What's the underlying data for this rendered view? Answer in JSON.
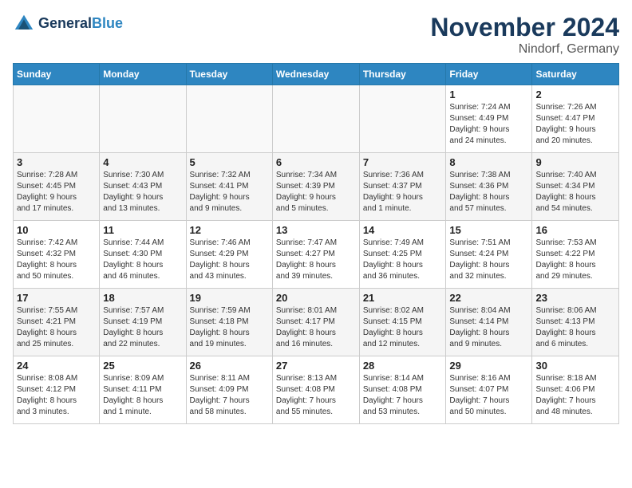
{
  "header": {
    "logo_line1": "General",
    "logo_line2": "Blue",
    "month": "November 2024",
    "location": "Nindorf, Germany"
  },
  "weekdays": [
    "Sunday",
    "Monday",
    "Tuesday",
    "Wednesday",
    "Thursday",
    "Friday",
    "Saturday"
  ],
  "weeks": [
    [
      {
        "day": "",
        "info": ""
      },
      {
        "day": "",
        "info": ""
      },
      {
        "day": "",
        "info": ""
      },
      {
        "day": "",
        "info": ""
      },
      {
        "day": "",
        "info": ""
      },
      {
        "day": "1",
        "info": "Sunrise: 7:24 AM\nSunset: 4:49 PM\nDaylight: 9 hours\nand 24 minutes."
      },
      {
        "day": "2",
        "info": "Sunrise: 7:26 AM\nSunset: 4:47 PM\nDaylight: 9 hours\nand 20 minutes."
      }
    ],
    [
      {
        "day": "3",
        "info": "Sunrise: 7:28 AM\nSunset: 4:45 PM\nDaylight: 9 hours\nand 17 minutes."
      },
      {
        "day": "4",
        "info": "Sunrise: 7:30 AM\nSunset: 4:43 PM\nDaylight: 9 hours\nand 13 minutes."
      },
      {
        "day": "5",
        "info": "Sunrise: 7:32 AM\nSunset: 4:41 PM\nDaylight: 9 hours\nand 9 minutes."
      },
      {
        "day": "6",
        "info": "Sunrise: 7:34 AM\nSunset: 4:39 PM\nDaylight: 9 hours\nand 5 minutes."
      },
      {
        "day": "7",
        "info": "Sunrise: 7:36 AM\nSunset: 4:37 PM\nDaylight: 9 hours\nand 1 minute."
      },
      {
        "day": "8",
        "info": "Sunrise: 7:38 AM\nSunset: 4:36 PM\nDaylight: 8 hours\nand 57 minutes."
      },
      {
        "day": "9",
        "info": "Sunrise: 7:40 AM\nSunset: 4:34 PM\nDaylight: 8 hours\nand 54 minutes."
      }
    ],
    [
      {
        "day": "10",
        "info": "Sunrise: 7:42 AM\nSunset: 4:32 PM\nDaylight: 8 hours\nand 50 minutes."
      },
      {
        "day": "11",
        "info": "Sunrise: 7:44 AM\nSunset: 4:30 PM\nDaylight: 8 hours\nand 46 minutes."
      },
      {
        "day": "12",
        "info": "Sunrise: 7:46 AM\nSunset: 4:29 PM\nDaylight: 8 hours\nand 43 minutes."
      },
      {
        "day": "13",
        "info": "Sunrise: 7:47 AM\nSunset: 4:27 PM\nDaylight: 8 hours\nand 39 minutes."
      },
      {
        "day": "14",
        "info": "Sunrise: 7:49 AM\nSunset: 4:25 PM\nDaylight: 8 hours\nand 36 minutes."
      },
      {
        "day": "15",
        "info": "Sunrise: 7:51 AM\nSunset: 4:24 PM\nDaylight: 8 hours\nand 32 minutes."
      },
      {
        "day": "16",
        "info": "Sunrise: 7:53 AM\nSunset: 4:22 PM\nDaylight: 8 hours\nand 29 minutes."
      }
    ],
    [
      {
        "day": "17",
        "info": "Sunrise: 7:55 AM\nSunset: 4:21 PM\nDaylight: 8 hours\nand 25 minutes."
      },
      {
        "day": "18",
        "info": "Sunrise: 7:57 AM\nSunset: 4:19 PM\nDaylight: 8 hours\nand 22 minutes."
      },
      {
        "day": "19",
        "info": "Sunrise: 7:59 AM\nSunset: 4:18 PM\nDaylight: 8 hours\nand 19 minutes."
      },
      {
        "day": "20",
        "info": "Sunrise: 8:01 AM\nSunset: 4:17 PM\nDaylight: 8 hours\nand 16 minutes."
      },
      {
        "day": "21",
        "info": "Sunrise: 8:02 AM\nSunset: 4:15 PM\nDaylight: 8 hours\nand 12 minutes."
      },
      {
        "day": "22",
        "info": "Sunrise: 8:04 AM\nSunset: 4:14 PM\nDaylight: 8 hours\nand 9 minutes."
      },
      {
        "day": "23",
        "info": "Sunrise: 8:06 AM\nSunset: 4:13 PM\nDaylight: 8 hours\nand 6 minutes."
      }
    ],
    [
      {
        "day": "24",
        "info": "Sunrise: 8:08 AM\nSunset: 4:12 PM\nDaylight: 8 hours\nand 3 minutes."
      },
      {
        "day": "25",
        "info": "Sunrise: 8:09 AM\nSunset: 4:11 PM\nDaylight: 8 hours\nand 1 minute."
      },
      {
        "day": "26",
        "info": "Sunrise: 8:11 AM\nSunset: 4:09 PM\nDaylight: 7 hours\nand 58 minutes."
      },
      {
        "day": "27",
        "info": "Sunrise: 8:13 AM\nSunset: 4:08 PM\nDaylight: 7 hours\nand 55 minutes."
      },
      {
        "day": "28",
        "info": "Sunrise: 8:14 AM\nSunset: 4:08 PM\nDaylight: 7 hours\nand 53 minutes."
      },
      {
        "day": "29",
        "info": "Sunrise: 8:16 AM\nSunset: 4:07 PM\nDaylight: 7 hours\nand 50 minutes."
      },
      {
        "day": "30",
        "info": "Sunrise: 8:18 AM\nSunset: 4:06 PM\nDaylight: 7 hours\nand 48 minutes."
      }
    ]
  ]
}
